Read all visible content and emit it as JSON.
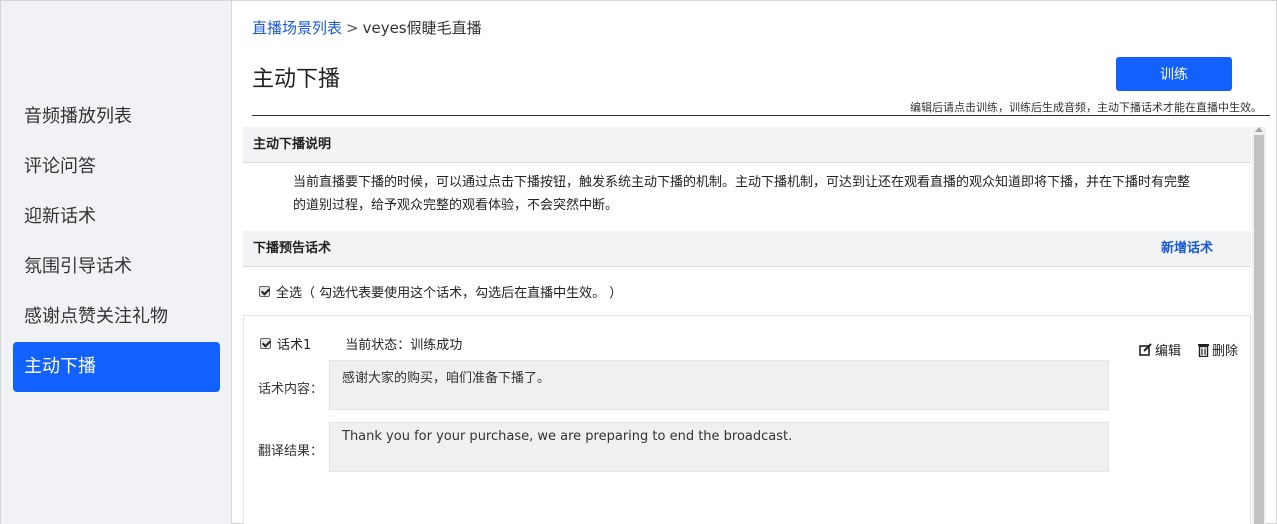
{
  "sidebar": {
    "items": [
      {
        "label": "音频播放列表"
      },
      {
        "label": "评论问答"
      },
      {
        "label": "迎新话术"
      },
      {
        "label": "氛围引导话术"
      },
      {
        "label": "感谢点赞关注礼物"
      },
      {
        "label": "主动下播",
        "active": true
      }
    ]
  },
  "breadcrumb": {
    "parent": "直播场景列表",
    "separator": ">",
    "current": "veyes假睫毛直播"
  },
  "header": {
    "title": "主动下播",
    "train_label": "训练",
    "hint": "编辑后请点击训练，训练后生成音频，主动下播话术才能在直播中生效。"
  },
  "explain": {
    "title": "主动下播说明",
    "text": "当前直播要下播的时候，可以通过点击下播按钮，触发系统主动下播的机制。主动下播机制，可达到让还在观看直播的观众知道即将下播，并在下播时有完整的道别过程，给予观众完整的观看体验，不会突然中断。"
  },
  "scripts": {
    "title": "下播预告话术",
    "add_label": "新增话术",
    "select_all_label": "全选（ 勾选代表要使用这个话术，勾选后在直播中生效。 ）",
    "items": [
      {
        "name": "话术1",
        "status": "当前状态：训练成功",
        "edit_label": "编辑",
        "delete_label": "删除",
        "content_label": "话术内容：",
        "content": "感谢大家的购买，咱们准备下播了。",
        "translation_label": "翻译结果：",
        "translation": "Thank you for your purchase, we are preparing to end the broadcast."
      }
    ]
  },
  "colors": {
    "accent": "#1261ff",
    "link": "#1a5ad8",
    "sidebar_bg": "#f1f2f5"
  }
}
